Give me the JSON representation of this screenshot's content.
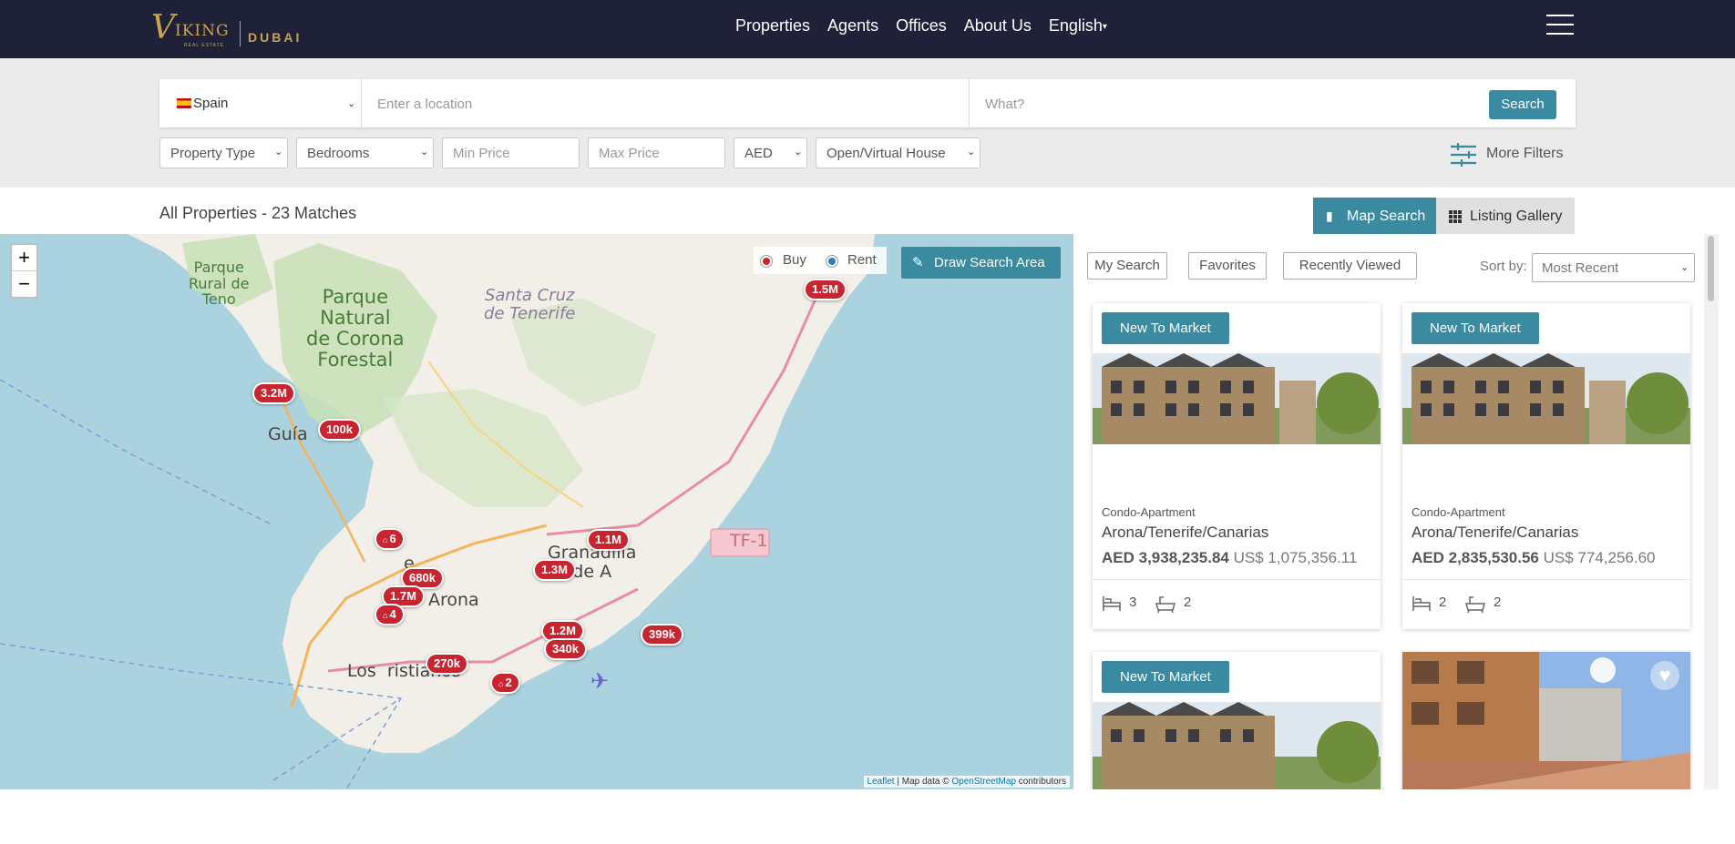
{
  "header": {
    "logo_brand": "VIKING",
    "logo_sub": "REAL ESTATE",
    "logo_city": "DUBAI",
    "nav": [
      "Properties",
      "Agents",
      "Offices",
      "About Us",
      "English"
    ]
  },
  "search": {
    "country": "Spain",
    "location_placeholder": "Enter a location",
    "what_placeholder": "What?",
    "search_label": "Search",
    "filters": {
      "property_type": "Property Type",
      "bedrooms": "Bedrooms",
      "min_price": "Min Price",
      "max_price": "Max Price",
      "currency": "AED",
      "open_house": "Open/Virtual House"
    },
    "more_filters": "More Filters"
  },
  "results": {
    "title": "All Properties - 23 Matches",
    "map_search": "Map Search",
    "listing_gallery": "Listing Gallery"
  },
  "map": {
    "zoom_in": "+",
    "zoom_out": "−",
    "buy_label": "Buy",
    "rent_label": "Rent",
    "draw_label": "Draw Search Area",
    "attribution_leaflet": "Leaflet",
    "attribution_rest": " | Map data © ",
    "attribution_osm": "OpenStreetMap",
    "attribution_end": " contributors",
    "place_labels": {
      "parque_rural": "Parque\nRural de\nTeno",
      "parque_natural": "Parque\nNatural\nde Corona\nForestal",
      "santa_cruz": "Santa Cruz\nde Tenerife",
      "guia": "Guía    ora",
      "granadilla": "Granadilla\nde A",
      "arona": "Arona",
      "los_cristianos": "Los  ristianos",
      "road": "TF-1",
      "e": "e"
    },
    "markers": {
      "m1": "1.5M",
      "m2": "3.2M",
      "m3": "100k",
      "m4": "6",
      "m5": "1.1M",
      "m6": "1.3M",
      "m7": "680k",
      "m8": "1.7M",
      "m9": "4",
      "m10": "1.2M",
      "m11": "340k",
      "m12": "399k",
      "m13": "270k",
      "m14": "2"
    }
  },
  "listing_tabs": {
    "my_search": "My Search",
    "favorites": "Favorites",
    "recently_viewed": "Recently Viewed",
    "sort_label": "Sort by:",
    "sort_value": "Most Recent"
  },
  "cards": [
    {
      "badge": "New To Market",
      "type": "Condo-Apartment",
      "location": "Arona/Tenerife/Canarias",
      "price_aed": "AED 3,938,235.84",
      "price_usd": "US$ 1,075,356.11",
      "beds": "3",
      "baths": "2"
    },
    {
      "badge": "New To Market",
      "type": "Condo-Apartment",
      "location": "Arona/Tenerife/Canarias",
      "price_aed": "AED 2,835,530.56",
      "price_usd": "US$ 774,256.60",
      "beds": "2",
      "baths": "2"
    },
    {
      "badge": "New To Market"
    }
  ],
  "colors": {
    "header_bg": "#1e2138",
    "accent": "#3a8aa0",
    "marker": "#c7252f",
    "gold": "#c9a34d",
    "sea": "#aad3df"
  }
}
